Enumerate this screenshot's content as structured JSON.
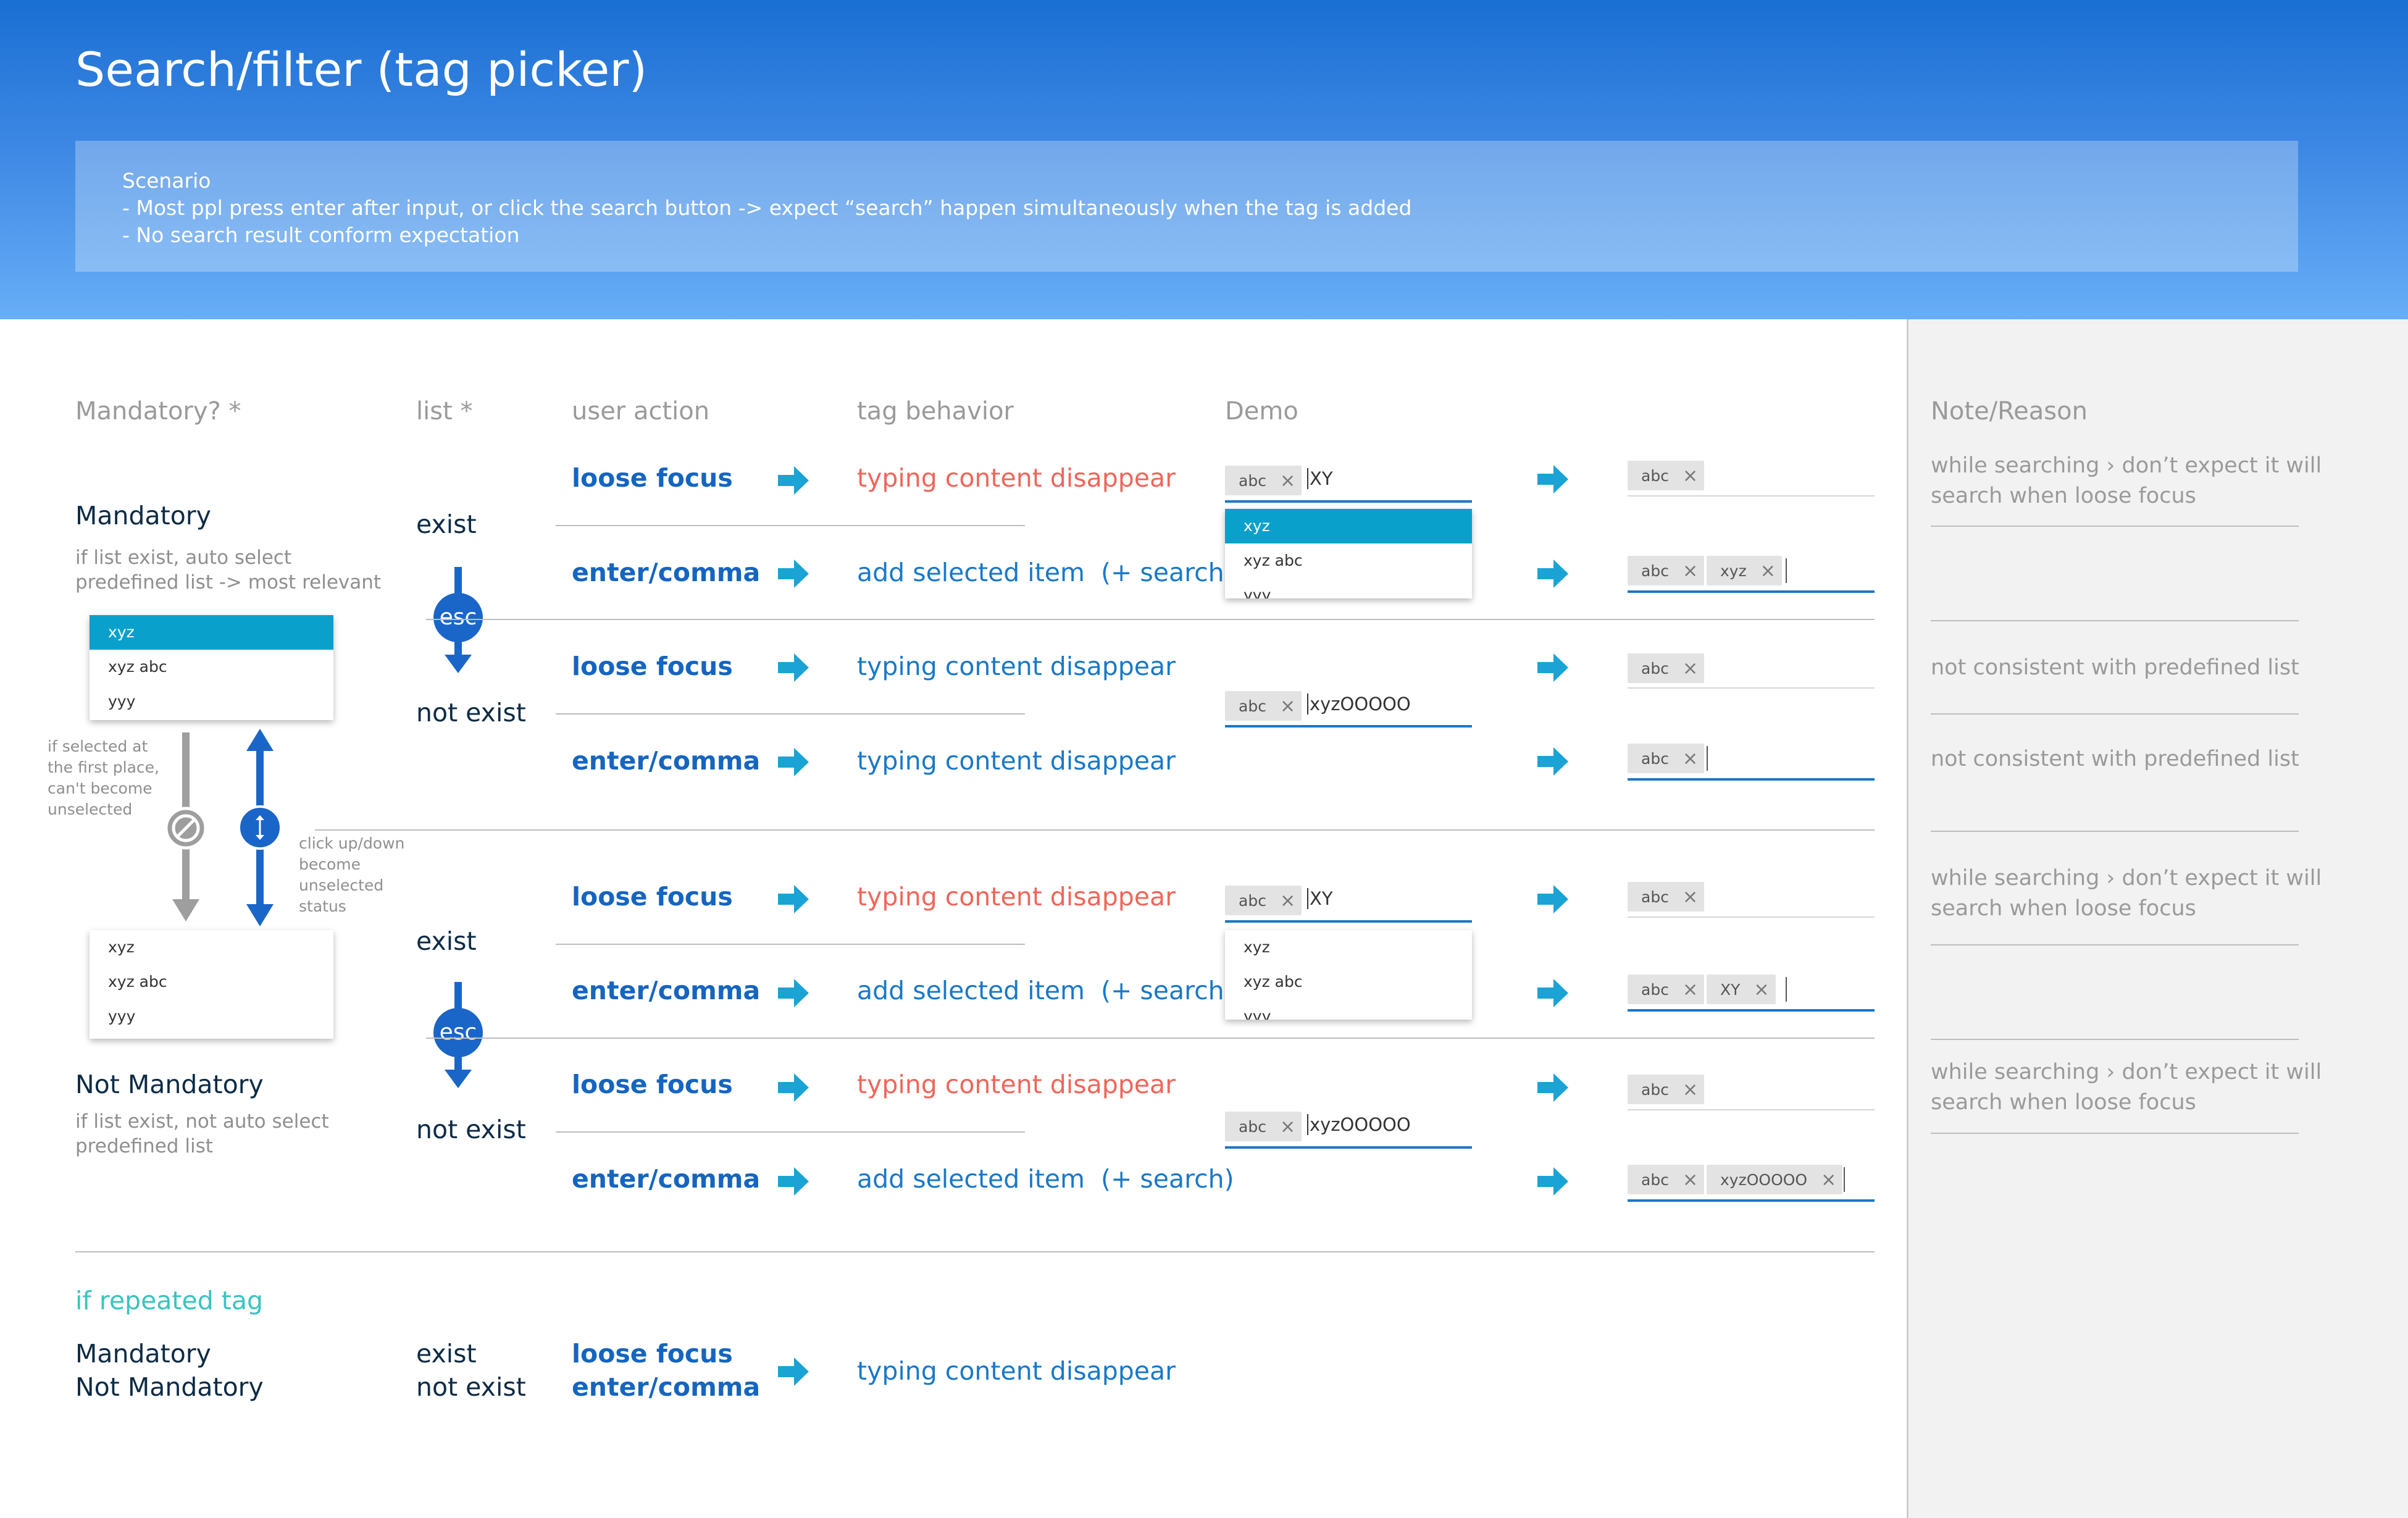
{
  "title": "Search/filter (tag picker)",
  "scenario": {
    "heading": "Scenario",
    "lines": [
      "- Most ppl press enter after input,  or click the search button -> expect “search” happen simultaneously when the tag is added",
      "- No search result conform expectation"
    ]
  },
  "columns": {
    "mandatory": "Mandatory? *",
    "list": "list *",
    "user_action": "user action",
    "tag_behavior": "tag behavior",
    "demo": "Demo",
    "note": "Note/Reason"
  },
  "mandatory": {
    "title": "Mandatory",
    "desc1": "if list exist, auto select",
    "desc2": "predefined list -> most relevant"
  },
  "not_mandatory": {
    "title": "Not Mandatory",
    "desc1": "if list exist, not auto select",
    "desc2": "predefined list"
  },
  "list_labels": {
    "exist": "exist",
    "not_exist": "not exist"
  },
  "actions": {
    "loose_focus": "loose focus",
    "enter_comma": "enter/comma"
  },
  "behaviors": {
    "disappear": "typing content disappear",
    "add": "add selected item",
    "add_search": "(+ search)"
  },
  "esc": "esc",
  "side_notes": {
    "selected_first": [
      "if selected at",
      "the first place,",
      "can't become",
      "unselected"
    ],
    "click_updown": [
      "click up/down",
      "become",
      "unselected",
      "status"
    ]
  },
  "dropdown": {
    "items": [
      "xyz",
      "xyz abc",
      "yyy"
    ]
  },
  "demo": {
    "chip_abc": "abc",
    "chip_xyz": "xyz",
    "chip_XY": "XY",
    "chip_long": "xyzOOOOO",
    "typed_XY": "XY",
    "typed_long": "xyzOOOOO",
    "close": "×"
  },
  "notes": {
    "searching_line1": "while searching › don’t expect it will",
    "searching_line2": "search when loose focus",
    "not_consistent": "not consistent with predefined list"
  },
  "repeated": {
    "title": "if repeated tag",
    "mandatory": "Mandatory",
    "not_mandatory": "Not Mandatory",
    "exist": "exist",
    "not_exist": "not exist",
    "loose_focus": "loose focus",
    "enter_comma": "enter/comma",
    "behavior": "typing content disappear"
  },
  "colors": {
    "header_top": "#1a6fd3",
    "header_bottom": "#68aef7",
    "action_blue": "#1565c0",
    "behavior_red": "#f0655a",
    "behavior_blue": "#1978c8",
    "arrow_teal": "#1aa3d4",
    "selected_row": "#0aa0cc",
    "teal_heading": "#37c4c0"
  }
}
